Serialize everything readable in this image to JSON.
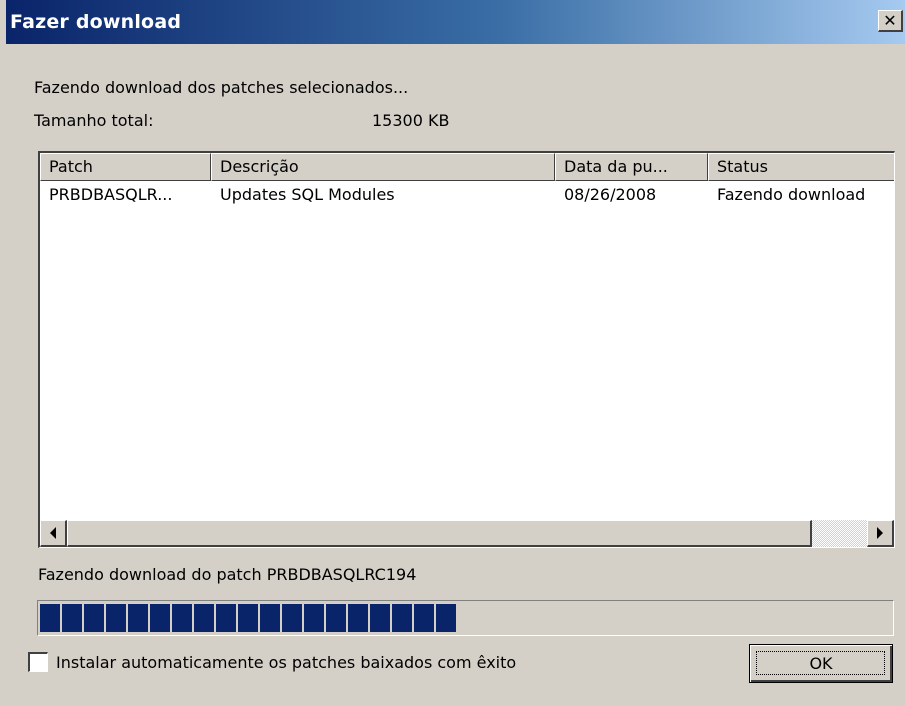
{
  "window": {
    "title": "Fazer download",
    "close_glyph": "✕"
  },
  "status": {
    "line1": "Fazendo download dos patches selecionados...",
    "size_label": "Tamanho total:",
    "size_value": "15300 KB"
  },
  "table": {
    "columns": [
      "Patch",
      "Descrição",
      "Data da pu...",
      "Status"
    ],
    "rows": [
      [
        "PRBDBASQLR...",
        "Updates SQL Modules",
        "08/26/2008",
        "Fazendo download"
      ]
    ]
  },
  "scrollbar": {
    "left_icon": "arrow-left-icon",
    "right_icon": "arrow-right-icon"
  },
  "current_patch_text": "Fazendo download do patch PRBDBASQLRC194",
  "progress": {
    "percent": 52,
    "blocks": 19,
    "color": "#0a246a"
  },
  "checkbox": {
    "label": "Instalar automaticamente os patches baixados com êxito",
    "checked": false
  },
  "ok_button": {
    "label": "OK"
  }
}
